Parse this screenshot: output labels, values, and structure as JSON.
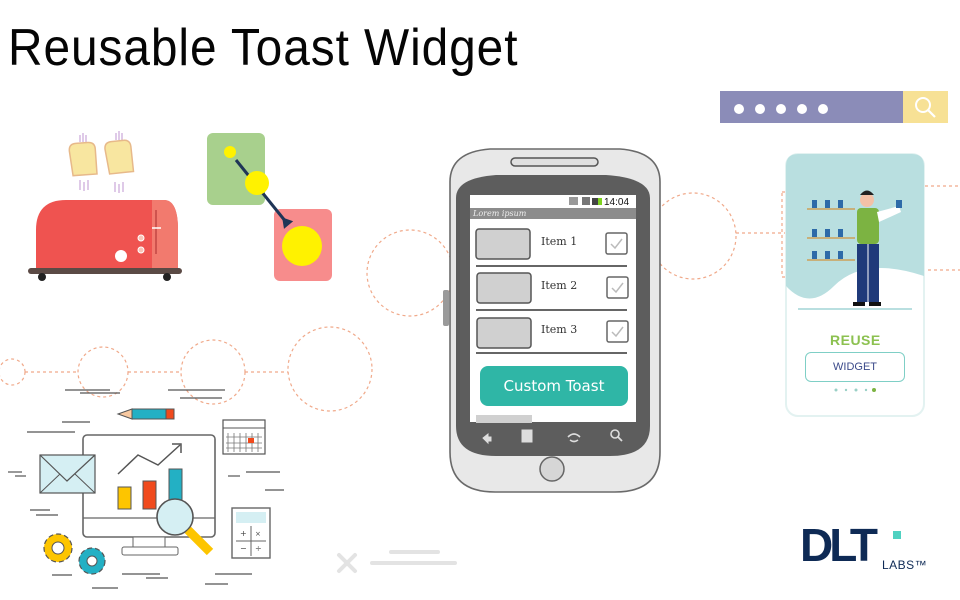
{
  "header": {
    "title": "Reusable Toast Widget"
  },
  "search_bar": {
    "masked_value": "•••••",
    "dot_count": 5,
    "icon": "search-icon",
    "colors": {
      "field": "#8b8cb8",
      "button": "#f7e195"
    }
  },
  "phone": {
    "status_bar": {
      "time": "14:04"
    },
    "app_bar_title": "Lorem ipsum",
    "list_items": [
      {
        "label": "Item 1",
        "checked": true
      },
      {
        "label": "Item 2",
        "checked": true
      },
      {
        "label": "Item 3",
        "checked": true
      }
    ],
    "toast": {
      "label": "Custom Toast",
      "color": "#2fb6a6"
    },
    "nav_icons": [
      "back-icon",
      "menu-icon",
      "home-icon",
      "search-icon"
    ]
  },
  "onboarding_mockup": {
    "heading": "REUSE",
    "button_label": "WIDGET",
    "heading_color": "#8cc150",
    "page_indicator": {
      "count": 5,
      "active": 5
    }
  },
  "logo": {
    "brand": "DLT",
    "suffix": "LABS™",
    "color": "#0e2a55",
    "accent": "#4fd1c1"
  },
  "illustrations": {
    "toaster": "toaster-illustration",
    "transition": "animation-transition-diagram",
    "analytics": "analytics-dashboard-illustration"
  }
}
